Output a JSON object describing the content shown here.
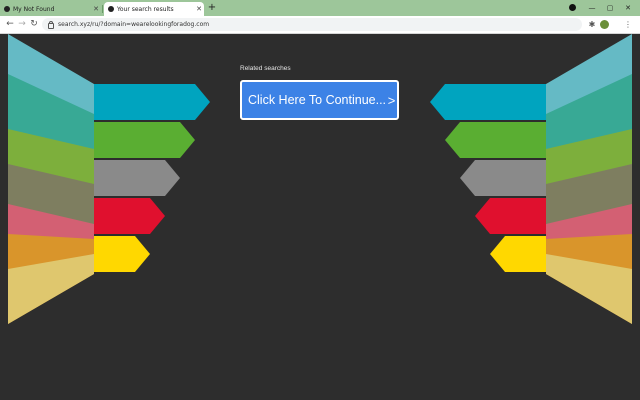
{
  "browser": {
    "tabs": [
      {
        "title": "My Not Found",
        "active": false
      },
      {
        "title": "Your search results",
        "active": true
      }
    ],
    "new_tab_label": "+",
    "address": "search.xyz/ru/?domain=wearelookingforadog.com",
    "icons": [
      "back-icon",
      "forward-icon",
      "reload-icon",
      "lock-icon",
      "extensions-icon",
      "profile-icon",
      "menu-icon"
    ]
  },
  "page": {
    "related_searches_label": "Related searches",
    "continue_button_label": "Click Here To Continue...",
    "continue_chevron": ">"
  },
  "colors": {
    "background": "#2d2d2d",
    "button": "#3c82e6",
    "arrow_teal": "#00a4bf",
    "arrow_green": "#5aae32",
    "arrow_gray": "#8a8a8a",
    "arrow_red": "#e0102e",
    "arrow_yellow": "#ffd800"
  }
}
